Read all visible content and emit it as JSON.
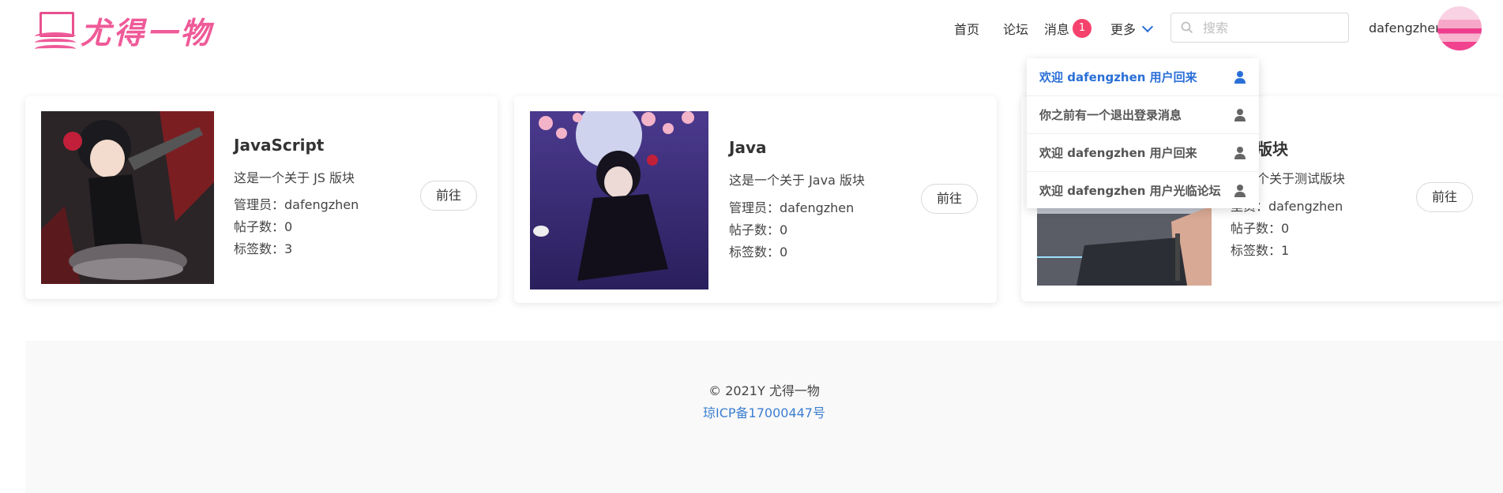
{
  "header": {
    "logo_text": "尤得一物",
    "nav": {
      "home": "首页",
      "forum": "论坛",
      "messages": "消息",
      "messages_badge": "1",
      "more": "更多"
    },
    "search": {
      "placeholder": "搜索",
      "value": ""
    },
    "user": {
      "name": "dafengzhen"
    }
  },
  "messages_dropdown": [
    {
      "text": "欢迎 dafengzhen 用户回来",
      "active": true
    },
    {
      "text": "你之前有一个退出登录消息",
      "active": false
    },
    {
      "text": "欢迎 dafengzhen 用户回来",
      "active": false
    },
    {
      "text": "欢迎 dafengzhen 用户光临论坛",
      "active": false
    }
  ],
  "cards": [
    {
      "title": "JavaScript",
      "desc": "这是一个关于 JS 版块",
      "admin": "管理员：dafengzhen",
      "posts": "帖子数：0",
      "tags": "标签数：3",
      "button": "前往"
    },
    {
      "title": "Java",
      "desc": "这是一个关于 Java 版块",
      "admin": "管理员：dafengzhen",
      "posts": "帖子数：0",
      "tags": "标签数：0",
      "button": "前往"
    },
    {
      "title": "版块",
      "desc": "个关于测试版块",
      "admin": "里员：dafengzhen",
      "posts": "帖子数：0",
      "tags": "标签数：1",
      "button": "前往"
    }
  ],
  "footer": {
    "copyright": "© 2021Y  尤得一物",
    "icp": "琼ICP备17000447号"
  },
  "colors": {
    "accent": "#2a6fd6",
    "badge": "#f5426c",
    "logo": "#ef5a98",
    "footer_bg": "#f9f9f9"
  }
}
